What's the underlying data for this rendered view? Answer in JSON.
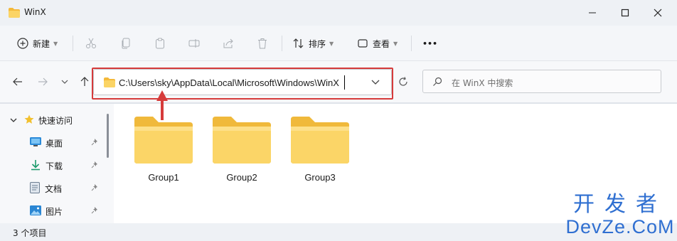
{
  "window": {
    "title": "WinX"
  },
  "toolbar": {
    "new_label": "新建",
    "sort_label": "排序",
    "view_label": "查看",
    "more_label": "•••"
  },
  "address": {
    "path": "C:\\Users\\sky\\AppData\\Local\\Microsoft\\Windows\\WinX"
  },
  "search": {
    "placeholder": "在 WinX 中搜索"
  },
  "sidebar": {
    "quick_access": "快速访问",
    "items": [
      {
        "label": "桌面",
        "icon": "desktop-icon"
      },
      {
        "label": "下载",
        "icon": "download-icon"
      },
      {
        "label": "文档",
        "icon": "document-icon"
      },
      {
        "label": "图片",
        "icon": "picture-icon"
      }
    ]
  },
  "folders": [
    {
      "name": "Group1"
    },
    {
      "name": "Group2"
    },
    {
      "name": "Group3"
    }
  ],
  "status": {
    "item_count": "3 个项目"
  },
  "watermark": {
    "line1": "开发者",
    "line2": "DevZe.CoM"
  },
  "colors": {
    "accent": "#d63b3b",
    "folder": "#f8cf4d",
    "watermark": "#2f6fd1"
  }
}
